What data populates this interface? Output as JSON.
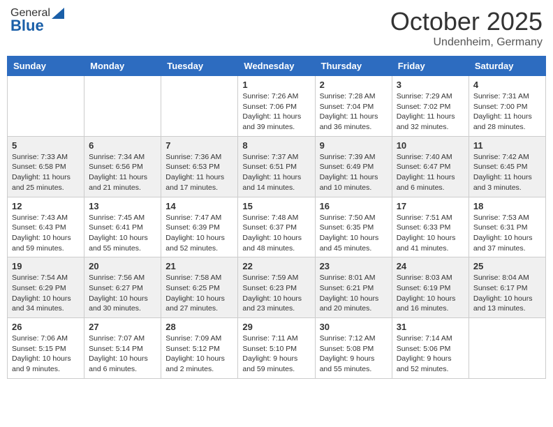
{
  "header": {
    "logo_general": "General",
    "logo_blue": "Blue",
    "month": "October 2025",
    "location": "Undenheim, Germany"
  },
  "days_of_week": [
    "Sunday",
    "Monday",
    "Tuesday",
    "Wednesday",
    "Thursday",
    "Friday",
    "Saturday"
  ],
  "weeks": [
    [
      {
        "day": "",
        "info": ""
      },
      {
        "day": "",
        "info": ""
      },
      {
        "day": "",
        "info": ""
      },
      {
        "day": "1",
        "info": "Sunrise: 7:26 AM\nSunset: 7:06 PM\nDaylight: 11 hours\nand 39 minutes."
      },
      {
        "day": "2",
        "info": "Sunrise: 7:28 AM\nSunset: 7:04 PM\nDaylight: 11 hours\nand 36 minutes."
      },
      {
        "day": "3",
        "info": "Sunrise: 7:29 AM\nSunset: 7:02 PM\nDaylight: 11 hours\nand 32 minutes."
      },
      {
        "day": "4",
        "info": "Sunrise: 7:31 AM\nSunset: 7:00 PM\nDaylight: 11 hours\nand 28 minutes."
      }
    ],
    [
      {
        "day": "5",
        "info": "Sunrise: 7:33 AM\nSunset: 6:58 PM\nDaylight: 11 hours\nand 25 minutes."
      },
      {
        "day": "6",
        "info": "Sunrise: 7:34 AM\nSunset: 6:56 PM\nDaylight: 11 hours\nand 21 minutes."
      },
      {
        "day": "7",
        "info": "Sunrise: 7:36 AM\nSunset: 6:53 PM\nDaylight: 11 hours\nand 17 minutes."
      },
      {
        "day": "8",
        "info": "Sunrise: 7:37 AM\nSunset: 6:51 PM\nDaylight: 11 hours\nand 14 minutes."
      },
      {
        "day": "9",
        "info": "Sunrise: 7:39 AM\nSunset: 6:49 PM\nDaylight: 11 hours\nand 10 minutes."
      },
      {
        "day": "10",
        "info": "Sunrise: 7:40 AM\nSunset: 6:47 PM\nDaylight: 11 hours\nand 6 minutes."
      },
      {
        "day": "11",
        "info": "Sunrise: 7:42 AM\nSunset: 6:45 PM\nDaylight: 11 hours\nand 3 minutes."
      }
    ],
    [
      {
        "day": "12",
        "info": "Sunrise: 7:43 AM\nSunset: 6:43 PM\nDaylight: 10 hours\nand 59 minutes."
      },
      {
        "day": "13",
        "info": "Sunrise: 7:45 AM\nSunset: 6:41 PM\nDaylight: 10 hours\nand 55 minutes."
      },
      {
        "day": "14",
        "info": "Sunrise: 7:47 AM\nSunset: 6:39 PM\nDaylight: 10 hours\nand 52 minutes."
      },
      {
        "day": "15",
        "info": "Sunrise: 7:48 AM\nSunset: 6:37 PM\nDaylight: 10 hours\nand 48 minutes."
      },
      {
        "day": "16",
        "info": "Sunrise: 7:50 AM\nSunset: 6:35 PM\nDaylight: 10 hours\nand 45 minutes."
      },
      {
        "day": "17",
        "info": "Sunrise: 7:51 AM\nSunset: 6:33 PM\nDaylight: 10 hours\nand 41 minutes."
      },
      {
        "day": "18",
        "info": "Sunrise: 7:53 AM\nSunset: 6:31 PM\nDaylight: 10 hours\nand 37 minutes."
      }
    ],
    [
      {
        "day": "19",
        "info": "Sunrise: 7:54 AM\nSunset: 6:29 PM\nDaylight: 10 hours\nand 34 minutes."
      },
      {
        "day": "20",
        "info": "Sunrise: 7:56 AM\nSunset: 6:27 PM\nDaylight: 10 hours\nand 30 minutes."
      },
      {
        "day": "21",
        "info": "Sunrise: 7:58 AM\nSunset: 6:25 PM\nDaylight: 10 hours\nand 27 minutes."
      },
      {
        "day": "22",
        "info": "Sunrise: 7:59 AM\nSunset: 6:23 PM\nDaylight: 10 hours\nand 23 minutes."
      },
      {
        "day": "23",
        "info": "Sunrise: 8:01 AM\nSunset: 6:21 PM\nDaylight: 10 hours\nand 20 minutes."
      },
      {
        "day": "24",
        "info": "Sunrise: 8:03 AM\nSunset: 6:19 PM\nDaylight: 10 hours\nand 16 minutes."
      },
      {
        "day": "25",
        "info": "Sunrise: 8:04 AM\nSunset: 6:17 PM\nDaylight: 10 hours\nand 13 minutes."
      }
    ],
    [
      {
        "day": "26",
        "info": "Sunrise: 7:06 AM\nSunset: 5:15 PM\nDaylight: 10 hours\nand 9 minutes."
      },
      {
        "day": "27",
        "info": "Sunrise: 7:07 AM\nSunset: 5:14 PM\nDaylight: 10 hours\nand 6 minutes."
      },
      {
        "day": "28",
        "info": "Sunrise: 7:09 AM\nSunset: 5:12 PM\nDaylight: 10 hours\nand 2 minutes."
      },
      {
        "day": "29",
        "info": "Sunrise: 7:11 AM\nSunset: 5:10 PM\nDaylight: 9 hours\nand 59 minutes."
      },
      {
        "day": "30",
        "info": "Sunrise: 7:12 AM\nSunset: 5:08 PM\nDaylight: 9 hours\nand 55 minutes."
      },
      {
        "day": "31",
        "info": "Sunrise: 7:14 AM\nSunset: 5:06 PM\nDaylight: 9 hours\nand 52 minutes."
      },
      {
        "day": "",
        "info": ""
      }
    ]
  ]
}
